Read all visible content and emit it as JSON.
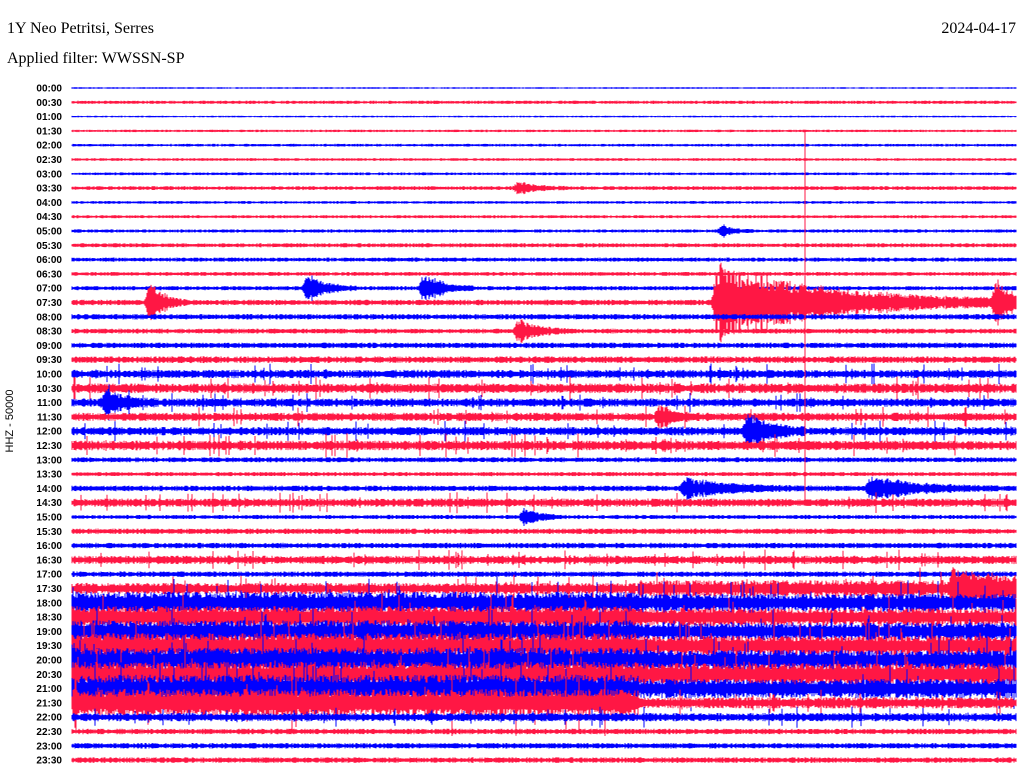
{
  "header": {
    "station": "1Y Neo Petritsi, Serres",
    "date": "2024-04-17",
    "filter": "Applied filter: WWSSN-SP"
  },
  "chart_data": {
    "type": "line",
    "title": "1Y Neo Petritsi, Serres",
    "ylabel": "HHZ - 50000",
    "xlabel": "",
    "x_range_minutes": [
      0,
      30
    ],
    "colors": [
      "#0000ff",
      "#ff1744"
    ],
    "rows": [
      "00:00",
      "00:30",
      "01:00",
      "01:30",
      "02:00",
      "02:30",
      "03:00",
      "03:30",
      "04:00",
      "04:30",
      "05:00",
      "05:30",
      "06:00",
      "06:30",
      "07:00",
      "07:30",
      "08:00",
      "08:30",
      "09:00",
      "09:30",
      "10:00",
      "10:30",
      "11:00",
      "11:30",
      "12:00",
      "12:30",
      "13:00",
      "13:30",
      "14:00",
      "14:30",
      "15:00",
      "15:30",
      "16:00",
      "16:30",
      "17:00",
      "17:30",
      "18:00",
      "18:30",
      "19:00",
      "19:30",
      "20:00",
      "20:30",
      "21:00",
      "21:30",
      "22:00",
      "22:30",
      "23:00",
      "23:30"
    ],
    "noise_level": [
      0.6,
      1.2,
      0.6,
      0.9,
      1,
      1,
      1,
      1.4,
      1,
      1.1,
      1.2,
      1.5,
      1.5,
      1.4,
      1.5,
      2,
      2,
      1.8,
      2,
      2.4,
      3,
      3.5,
      3,
      3,
      3,
      3.5,
      1.8,
      1.5,
      2,
      3,
      1.5,
      2,
      2,
      3,
      2,
      4,
      8,
      8,
      8,
      9,
      9,
      9,
      10,
      10,
      3,
      2,
      2,
      2
    ],
    "late_noise_factor": [
      1,
      1,
      1,
      1,
      1,
      1,
      1,
      1,
      1,
      1,
      1,
      1,
      1,
      1,
      1,
      1,
      1,
      1,
      1,
      1,
      1,
      1,
      1,
      1,
      1,
      1,
      1,
      1,
      1,
      1,
      1,
      1,
      1,
      1,
      1,
      1.5,
      0.8,
      0.8,
      0.8,
      0.8,
      0.8,
      0.9,
      0.7,
      0.4,
      1,
      1,
      1,
      1
    ],
    "events": [
      {
        "row": "03:30",
        "minute": 14.2,
        "amplitude": 6,
        "duration": 0.8
      },
      {
        "row": "05:00",
        "minute": 20.7,
        "amplitude": 6,
        "duration": 0.5
      },
      {
        "row": "07:00",
        "minute": 7.5,
        "amplitude": 14,
        "duration": 0.8
      },
      {
        "row": "07:00",
        "minute": 11.2,
        "amplitude": 16,
        "duration": 0.8
      },
      {
        "row": "07:30",
        "minute": 2.5,
        "amplitude": 22,
        "duration": 0.6
      },
      {
        "row": "07:30",
        "minute": 20.5,
        "amplitude": 40,
        "duration": 5
      },
      {
        "row": "07:30",
        "minute": 29.4,
        "amplitude": 22,
        "duration": 0.6
      },
      {
        "row": "08:30",
        "minute": 14.2,
        "amplitude": 12,
        "duration": 0.8
      },
      {
        "row": "11:00",
        "minute": 1.1,
        "amplitude": 12,
        "duration": 0.8
      },
      {
        "row": "11:30",
        "minute": 18.7,
        "amplitude": 10,
        "duration": 0.6
      },
      {
        "row": "12:00",
        "minute": 21.5,
        "amplitude": 18,
        "duration": 0.9
      },
      {
        "row": "14:00",
        "minute": 19.5,
        "amplitude": 10,
        "duration": 2
      },
      {
        "row": "14:00",
        "minute": 25.4,
        "amplitude": 12,
        "duration": 2
      },
      {
        "row": "15:00",
        "minute": 14.4,
        "amplitude": 9,
        "duration": 0.6
      },
      {
        "row": "17:30",
        "minute": 28,
        "amplitude": 14,
        "duration": 3
      }
    ]
  }
}
